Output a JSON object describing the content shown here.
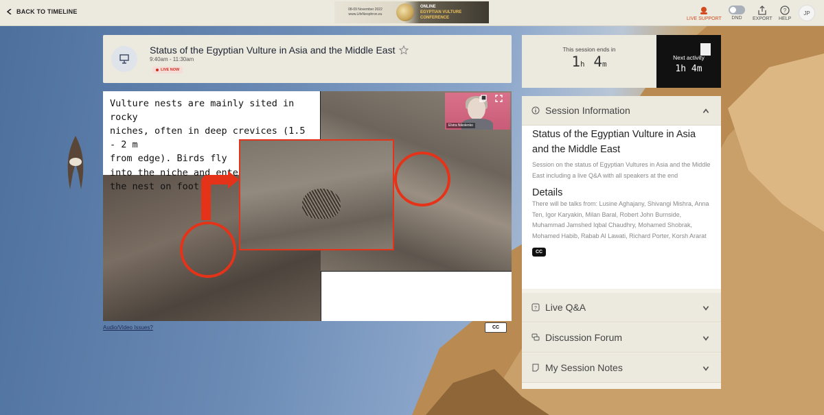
{
  "topbar": {
    "back_label": "BACK TO TIMELINE",
    "banner": {
      "dates": "08-09 November 2022",
      "site": "www.LifeNeophron.eu",
      "title_line1": "ONLINE",
      "title_line2": "EGYPTIAN VULTURE",
      "title_line3": "CONFERENCE"
    },
    "live_support_label": "LIVE SUPPORT",
    "dnd_label": "DND",
    "export_label": "EXPORT",
    "help_label": "HELP",
    "avatar_initials": "JP",
    "accent_color": "#d24a1e"
  },
  "session": {
    "title": "Status of the Egyptian Vulture in Asia and the Middle East",
    "time": "9:40am - 11:30am",
    "live_badge": "LIVE NOW"
  },
  "video": {
    "slide_text": "Vulture nests are mainly sited in rocky niches, often in deep crevices (1.5 - 2 m from edge). Birds fly into the niche and enter the nest on foot.",
    "slide_lines": [
      "Vulture nests are mainly sited in rocky",
      "niches, often in deep crevices (1.5 - 2 m",
      "from edge). Birds fly",
      "into the niche and enter",
      "the nest on foot."
    ],
    "speaker_name": "Elvira Nikolenko",
    "audio_issues_link": "Audio/Video Issues?",
    "cc_label": "CC"
  },
  "timer": {
    "ends_label": "This session ends in",
    "ends_hours": "1",
    "ends_hours_unit": "h",
    "ends_minutes": "4",
    "ends_minutes_unit": "m",
    "next_label": "Next activity",
    "next_time": "1h 4m"
  },
  "panel": {
    "session_info_label": "Session Information",
    "info_title": "Status of the Egyptian Vulture in Asia and the Middle East",
    "info_description": "Session on the status of Egyptian Vultures in Asia and the Middle East including a live Q&A with all speakers at the end",
    "details_heading": "Details",
    "details_text": "There will be talks from: Lusine Aghajany, Shivangi Mishra, Anna Ten, Igor Karyakin, Milan Baral, Robert John Burnside, Muhammad Jamshed Iqbal Chaudhry, Mohamed Shobrak, Mohamed Habib, Rabab Al Lawati, Richard Porter, Korsh Ararat",
    "cc_badge": "CC",
    "live_qa_label": "Live Q&A",
    "discussion_label": "Discussion Forum",
    "notes_label": "My Session Notes"
  }
}
